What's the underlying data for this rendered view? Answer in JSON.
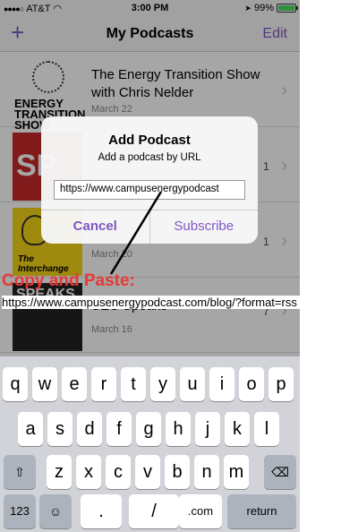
{
  "status": {
    "carrier": "AT&T",
    "time": "3:00 PM",
    "battery": "99%",
    "battery_level": 0.99
  },
  "nav": {
    "add_icon": "+",
    "title": "My Podcasts",
    "edit": "Edit"
  },
  "podcasts": [
    {
      "title": "The Energy Transition Show with Chris Nelder",
      "date": "March 22",
      "count": "",
      "art_text": "ENERGY TRANSITION SHOW"
    },
    {
      "title": "",
      "date": "",
      "count": "1",
      "art_text": "SP"
    },
    {
      "title": "",
      "date": "March 20",
      "count": "1",
      "art_text": "The Interchange"
    },
    {
      "title": "SEC Speaks",
      "date": "March 16",
      "count": "7",
      "art_text": "SPEAKS"
    }
  ],
  "alert": {
    "title": "Add Podcast",
    "subtitle": "Add a podcast by URL",
    "input_value": "https://www.campusenergypodcast",
    "cancel": "Cancel",
    "subscribe": "Subscribe"
  },
  "annotation": {
    "label": "Copy and Paste:",
    "url": "https://www.campusenergypodcast.com/blog/?format=rss",
    "color": "#e53935"
  },
  "keyboard": {
    "row1": [
      "q",
      "w",
      "e",
      "r",
      "t",
      "y",
      "u",
      "i",
      "o",
      "p"
    ],
    "row2": [
      "a",
      "s",
      "d",
      "f",
      "g",
      "h",
      "j",
      "k",
      "l"
    ],
    "row3": [
      "z",
      "x",
      "c",
      "v",
      "b",
      "n",
      "m"
    ],
    "shift": "⇧",
    "delete": "⌫",
    "numbers": "123",
    "emoji": "☺",
    "dot": ".",
    "slash": "/",
    "dotcom": ".com",
    "return": "return"
  },
  "accent_color": "#7e57c2"
}
